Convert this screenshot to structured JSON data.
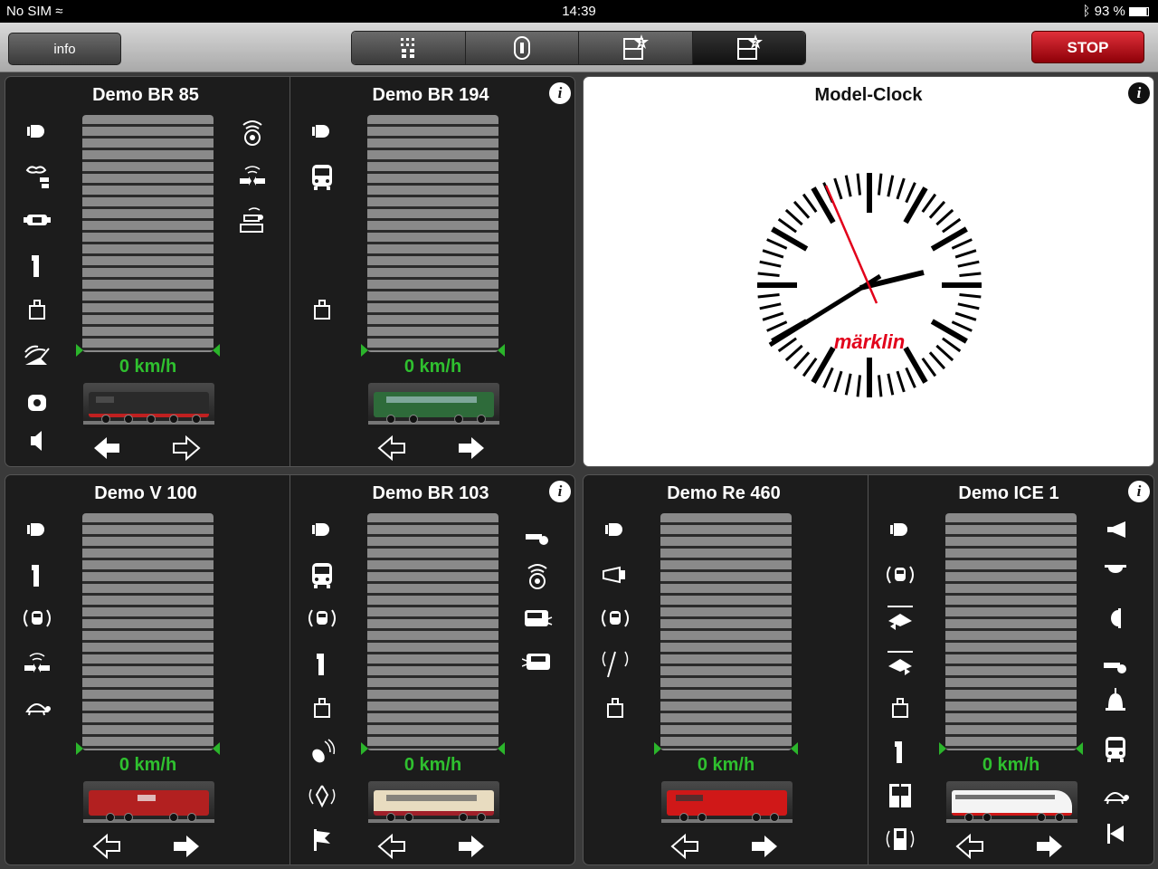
{
  "status_bar": {
    "carrier": "No SIM",
    "time": "14:39",
    "battery": "93 %"
  },
  "toolbar": {
    "info_label": "info",
    "segments": [
      "keyboard-view",
      "loco-view",
      "layout-1-view",
      "layout-2-view"
    ],
    "stop_label": "STOP"
  },
  "panels": [
    {
      "locos": [
        {
          "name": "Demo BR 85",
          "speed": "0 km/h",
          "train_color": "#3a3a3a"
        },
        {
          "name": "Demo BR 194",
          "speed": "0 km/h",
          "train_color": "#2e6b3a"
        }
      ]
    },
    {
      "clock": {
        "title": "Model-Clock",
        "brand": "märklin"
      }
    },
    {
      "locos": [
        {
          "name": "Demo V 100",
          "speed": "0 km/h",
          "train_color": "#b22020"
        },
        {
          "name": "Demo BR 103",
          "speed": "0 km/h",
          "train_color": "#e8dcc0"
        }
      ]
    },
    {
      "locos": [
        {
          "name": "Demo Re 460",
          "speed": "0 km/h",
          "train_color": "#d01818"
        },
        {
          "name": "Demo ICE 1",
          "speed": "0 km/h",
          "train_color": "#f4f4f4"
        }
      ]
    }
  ],
  "info_icon": "i",
  "colors": {
    "speed_green": "#2fc02f",
    "stop_red": "#c4101a",
    "marklin_red": "#e2001a"
  }
}
